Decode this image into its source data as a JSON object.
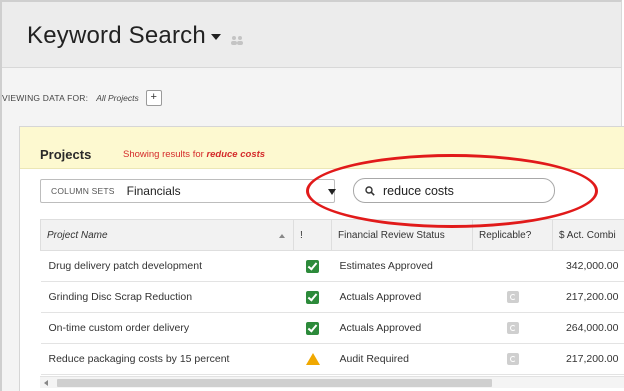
{
  "header": {
    "title": "Keyword Search"
  },
  "filter": {
    "viewing_label": "VIEWING DATA FOR:",
    "viewing_value": "All Projects",
    "add_label": "+"
  },
  "projects": {
    "title": "Projects",
    "showing_prefix": "Showing results for",
    "showing_keyword": "reduce costs",
    "column_sets_label": "COLUMN SETS",
    "column_sets_value": "Financials"
  },
  "search": {
    "value": "reduce costs"
  },
  "table": {
    "columns": [
      "Project Name",
      "!",
      "Financial Review Status",
      "Replicable?",
      "$ Act. Combi"
    ],
    "rows": [
      {
        "name": "Drug delivery patch development",
        "flag": "check-icon",
        "status": "Estimates Approved",
        "replicable": "",
        "amount": "342,000.00"
      },
      {
        "name": "Grinding Disc Scrap Reduction",
        "flag": "check-icon",
        "status": "Actuals Approved",
        "replicable": "replicate-icon",
        "amount": "217,200.00"
      },
      {
        "name": "On-time custom order delivery",
        "flag": "check-icon",
        "status": "Actuals Approved",
        "replicable": "replicate-icon",
        "amount": "264,000.00"
      },
      {
        "name": "Reduce packaging costs by 15 percent",
        "flag": "warning-icon",
        "status": "Audit Required",
        "replicable": "replicate-icon",
        "amount": "217,200.00"
      }
    ]
  },
  "colors": {
    "accent_red": "#d42b2b",
    "highlight_banner": "#fdf9d0",
    "check_green": "#2c8a3a",
    "warning_orange": "#f0a800"
  }
}
